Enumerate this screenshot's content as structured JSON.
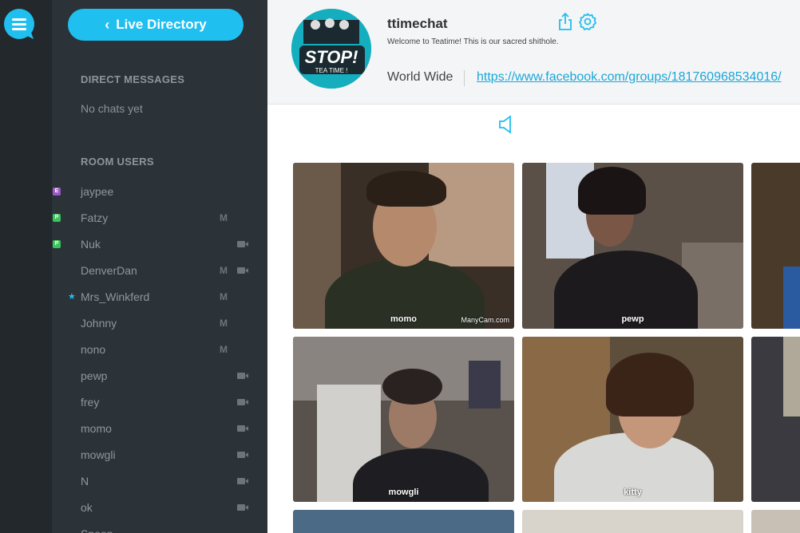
{
  "sidebar": {
    "live_directory_label": "Live Directory",
    "direct_messages_title": "DIRECT MESSAGES",
    "no_chats": "No chats yet",
    "room_users_title": "ROOM USERS",
    "users": [
      {
        "name": "jaypee",
        "badge": "E",
        "mod": false,
        "cam": false
      },
      {
        "name": "Fatzy",
        "badge": "P",
        "mod": true,
        "cam": false
      },
      {
        "name": "Nuk",
        "badge": "P",
        "mod": false,
        "cam": true
      },
      {
        "name": "DenverDan",
        "badge": "",
        "mod": true,
        "cam": true
      },
      {
        "name": "Mrs_Winkferd",
        "badge": "",
        "star": true,
        "mod": true,
        "cam": false
      },
      {
        "name": "Johnny",
        "badge": "",
        "mod": true,
        "cam": false
      },
      {
        "name": "nono",
        "badge": "",
        "mod": true,
        "cam": false
      },
      {
        "name": "pewp",
        "badge": "",
        "mod": false,
        "cam": true
      },
      {
        "name": "frey",
        "badge": "",
        "mod": false,
        "cam": true
      },
      {
        "name": "momo",
        "badge": "",
        "mod": false,
        "cam": true
      },
      {
        "name": "mowgli",
        "badge": "",
        "mod": false,
        "cam": true
      },
      {
        "name": "N",
        "badge": "",
        "mod": false,
        "cam": true
      },
      {
        "name": "ok",
        "badge": "",
        "mod": false,
        "cam": true
      },
      {
        "name": "Spoon",
        "badge": "",
        "mod": false,
        "cam": false
      }
    ],
    "mod_flag": "M"
  },
  "room": {
    "name": "ttimechat",
    "description": "Welcome to Teatime! This is our sacred shithole.",
    "location": "World Wide",
    "link": "https://www.facebook.com/groups/181760968534016/",
    "avatar_text_1": "STOP!",
    "avatar_text_2": "TEA TIME !"
  },
  "videos": [
    {
      "name": "momo",
      "watermark": "ManyCam.com"
    },
    {
      "name": "pewp"
    },
    {
      "name": "mowgli"
    },
    {
      "name": "kitty"
    }
  ],
  "colors": {
    "accent": "#1fbff0",
    "sidebar": "#2c3338",
    "rail": "#22282c"
  }
}
